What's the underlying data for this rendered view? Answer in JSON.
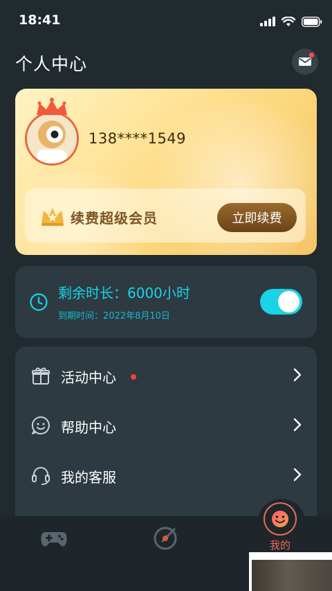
{
  "status_bar": {
    "time": "18:41"
  },
  "header": {
    "title": "个人中心",
    "mail_icon": "mail-icon"
  },
  "vip_card": {
    "phone": "138****1549",
    "strip_label": "续费超级会员",
    "renew_button": "立即续费"
  },
  "time_card": {
    "remaining": "剩余时长：6000小时",
    "expire": "到期时间：2022年8月10日",
    "toggle_on": true
  },
  "menu": {
    "items": [
      {
        "label": "活动中心",
        "icon": "gift-icon",
        "badge": true
      },
      {
        "label": "帮助中心",
        "icon": "smile-chat-icon",
        "badge": false
      },
      {
        "label": "我的客服",
        "icon": "headset-icon",
        "badge": false
      }
    ]
  },
  "tabbar": {
    "tabs": [
      {
        "icon": "gamepad-icon",
        "label": ""
      },
      {
        "icon": "rocket-icon",
        "label": ""
      },
      {
        "icon": "smile-icon",
        "label": "我的"
      }
    ]
  },
  "colors": {
    "accent": "#19d3e6",
    "tab_active": "#e96a55",
    "badge": "#ff3b3b"
  }
}
